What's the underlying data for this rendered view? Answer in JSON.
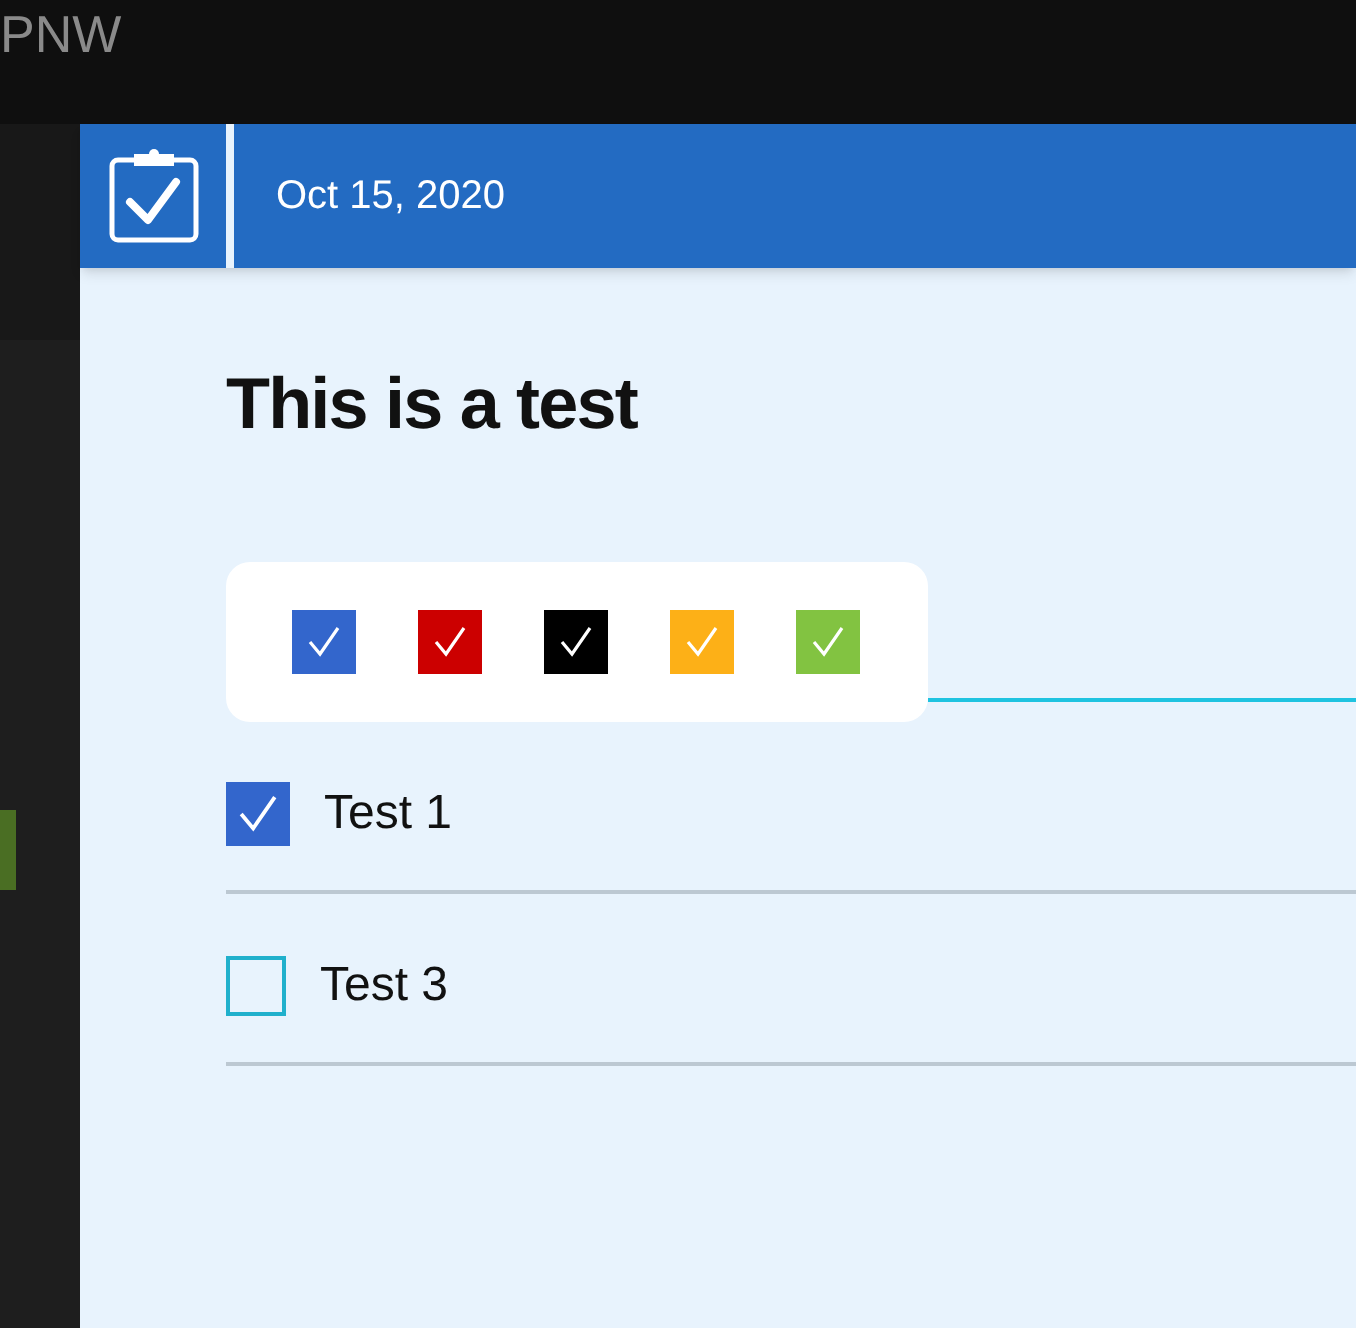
{
  "app_title": "PNW",
  "header": {
    "date": "Oct 15, 2020"
  },
  "title": "This is a test",
  "palette": [
    {
      "color": "#3366cc"
    },
    {
      "color": "#cc0000"
    },
    {
      "color": "#000000"
    },
    {
      "color": "#fdb017"
    },
    {
      "color": "#82c341"
    }
  ],
  "items": [
    {
      "label": "Test 1",
      "checked": true
    },
    {
      "label": "Test 3",
      "checked": false
    }
  ]
}
